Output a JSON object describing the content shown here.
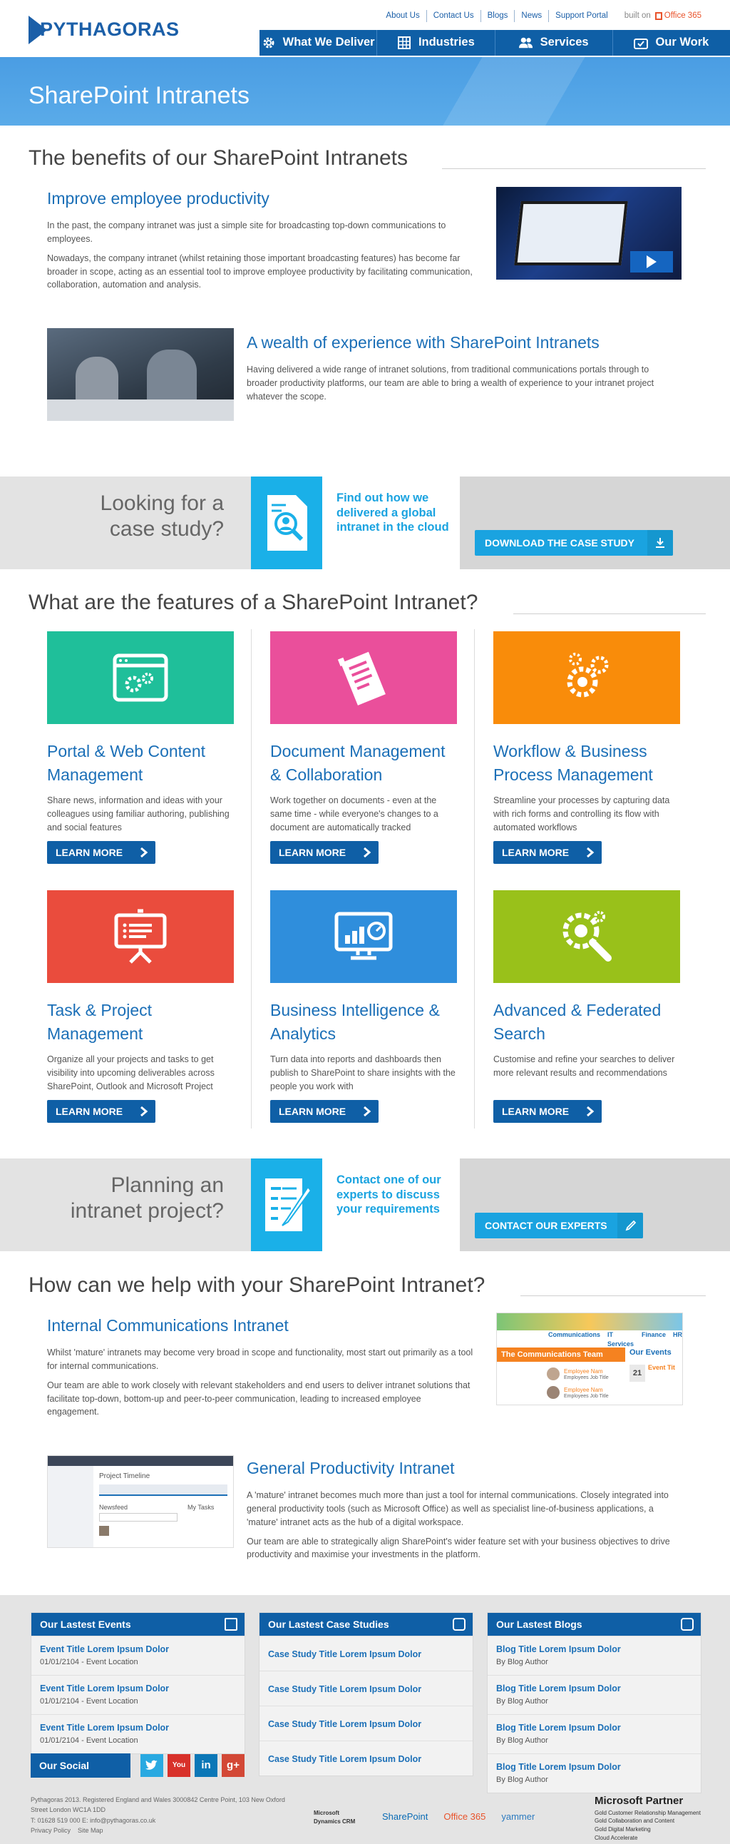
{
  "header": {
    "logo_text": "PYTHAGORAS",
    "top_links": [
      "About Us",
      "Contact Us",
      "Blogs",
      "News",
      "Support Portal"
    ],
    "built_on": "built on",
    "office365": "Office 365",
    "nav": [
      {
        "label": "What We Deliver",
        "icon": "gear-icon"
      },
      {
        "label": "Industries",
        "icon": "grid-icon"
      },
      {
        "label": "Services",
        "icon": "people-icon"
      },
      {
        "label": "Our Work",
        "icon": "briefcase-icon"
      }
    ]
  },
  "banner": {
    "title": "SharePoint Intranets"
  },
  "benefits": {
    "heading": "The benefits of our SharePoint Intranets",
    "item1": {
      "title": "Improve employee productivity",
      "p1": "In the past, the company intranet was just a simple site for broadcasting top-down communications to employees.",
      "p2": "Nowadays, the company intranet (whilst retaining those important broadcasting features) has become far broader in scope, acting as an essential tool to improve employee productivity by facilitating communication, collaboration, automation and analysis."
    },
    "item2": {
      "title": "A wealth of experience with SharePoint Intranets",
      "p1": "Having delivered a wide range of intranet solutions, from traditional communications portals through to broader productivity platforms, our team are able to bring a wealth of experience to your intranet project whatever the scope."
    }
  },
  "cta1": {
    "left": "Looking for a case study?",
    "middle": "Find out how we delivered a global intranet in the cloud",
    "button": "DOWNLOAD THE CASE STUDY"
  },
  "features": {
    "heading": "What are the features of a SharePoint Intranet?",
    "learn_more": "LEARN MORE",
    "items": [
      {
        "title": "Portal & Web Content Management",
        "text": "Share news, information and ideas with your colleagues using familiar authoring, publishing and social features",
        "color": "#1fbf9a",
        "icon": "browser-gear-icon"
      },
      {
        "title": "Document Management & Collaboration",
        "text": "Work together on documents - even at the same time - while everyone's changes to a document are automatically tracked",
        "color": "#ea4f9b",
        "icon": "document-icon"
      },
      {
        "title": "Workflow & Business Process Management",
        "text": "Streamline your processes by capturing data with rich forms and controlling its flow with automated workflows",
        "color": "#f98c0a",
        "icon": "gears-icon"
      },
      {
        "title": "Task & Project Management",
        "text": "Organize all your projects and tasks to get visibility into upcoming deliverables across SharePoint, Outlook and Microsoft Project",
        "color": "#ea4c3d",
        "icon": "presentation-icon"
      },
      {
        "title": "Business Intelligence & Analytics",
        "text": "Turn data into reports and dashboards then publish to SharePoint to share insights with the people you work with",
        "color": "#2f8edc",
        "icon": "dashboard-icon"
      },
      {
        "title": "Advanced & Federated Search",
        "text": "Customise and refine your searches to deliver more relevant results and recommendations",
        "color": "#99c11a",
        "icon": "search-gear-icon"
      }
    ]
  },
  "cta2": {
    "left": "Planning an intranet project?",
    "middle": "Contact one of our experts to discuss your requirements",
    "button": "CONTACT OUR EXPERTS"
  },
  "help": {
    "heading": "How can we help with your SharePoint Intranet?",
    "item1": {
      "title": "Internal Communications Intranet",
      "p1": "Whilst 'mature' intranets may become very broad in scope and functionality, most start out primarily as a tool for internal communications.",
      "p2": "Our team are able to work closely with relevant stakeholders and end users to deliver intranet solutions that facilitate top-down, bottom-up and peer-to-peer communication, leading to increased employee engagement."
    },
    "item2": {
      "title": "General Productivity Intranet",
      "p1": "A 'mature' intranet becomes much more than just a tool for internal communications.  Closely integrated into general productivity tools (such as Microsoft Office) as well as specialist line-of-business applications, a 'mature' intranet acts as the hub of a digital workspace.",
      "p2": "Our team are able to strategically align SharePoint's wider feature set with your business objectives to drive productivity and maximise your investments in the platform."
    },
    "shot1": {
      "tabs": [
        "Communications",
        "IT Services",
        "Finance",
        "HR"
      ],
      "team": "The Communications Team",
      "events": "Our Events",
      "event_title": "Event Tit",
      "employee": "Employee Nam",
      "job": "Employees Job Title",
      "date_num": "21"
    },
    "shot2": {
      "title": "Project Timeline",
      "newsfeed": "Newsfeed",
      "tasks": "My Tasks"
    }
  },
  "footer": {
    "events": {
      "title": "Our Lastest Events",
      "rows": [
        {
          "title": "Event Title Lorem Ipsum Dolor",
          "sub": "01/01/2104 - Event Location"
        },
        {
          "title": "Event Title Lorem Ipsum Dolor",
          "sub": "01/01/2104 - Event Location"
        },
        {
          "title": "Event Title Lorem Ipsum Dolor",
          "sub": "01/01/2104 - Event Location"
        }
      ]
    },
    "cases": {
      "title": "Our Lastest Case Studies",
      "rows": [
        "Case Study Title Lorem Ipsum Dolor",
        "Case Study Title Lorem Ipsum Dolor",
        "Case Study Title Lorem Ipsum Dolor",
        "Case Study Title Lorem Ipsum Dolor"
      ]
    },
    "blogs": {
      "title": "Our Lastest Blogs",
      "rows": [
        {
          "title": "Blog Title Lorem Ipsum Dolor",
          "sub": "By Blog Author"
        },
        {
          "title": "Blog Title Lorem Ipsum Dolor",
          "sub": "By Blog Author"
        },
        {
          "title": "Blog Title Lorem Ipsum Dolor",
          "sub": "By Blog Author"
        },
        {
          "title": "Blog Title Lorem Ipsum Dolor",
          "sub": "By Blog Author"
        }
      ]
    },
    "social_label": "Our Social",
    "social": [
      "twitter-icon",
      "youtube-icon",
      "linkedin-icon",
      "googleplus-icon"
    ],
    "legal1": "Pythagoras 2013. Registered England and Wales 3000842 Centre Point, 103 New Oxford Street London WC1A 1DD",
    "legal2": "T: 01628 519 000 E: info@pythagoras.co.uk",
    "privacy": "Privacy Policy",
    "sitemap": "Site Map",
    "partners": [
      "Microsoft Dynamics CRM",
      "SharePoint",
      "Office 365",
      "yammer"
    ],
    "ms_partner": "Microsoft Partner",
    "ms_lines": [
      "Gold Customer Relationship Management",
      "Gold Collaboration and Content",
      "Gold Digital Marketing",
      "Cloud Accelerate"
    ]
  }
}
